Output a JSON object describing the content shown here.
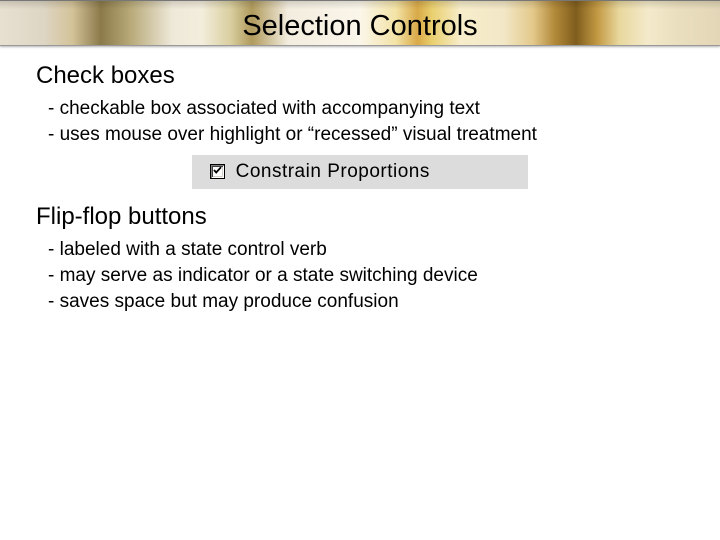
{
  "title": "Selection Controls",
  "sections": [
    {
      "heading": "Check boxes",
      "bullets": [
        "- checkable box associated with accompanying text",
        "- uses mouse over highlight or “recessed” visual treatment"
      ],
      "example_label": "Constrain Proportions",
      "example_checked": true
    },
    {
      "heading": "Flip-flop buttons",
      "bullets": [
        "- labeled with a state control verb",
        "- may serve as indicator or a state switching device",
        "- saves space but may produce confusion"
      ]
    }
  ]
}
